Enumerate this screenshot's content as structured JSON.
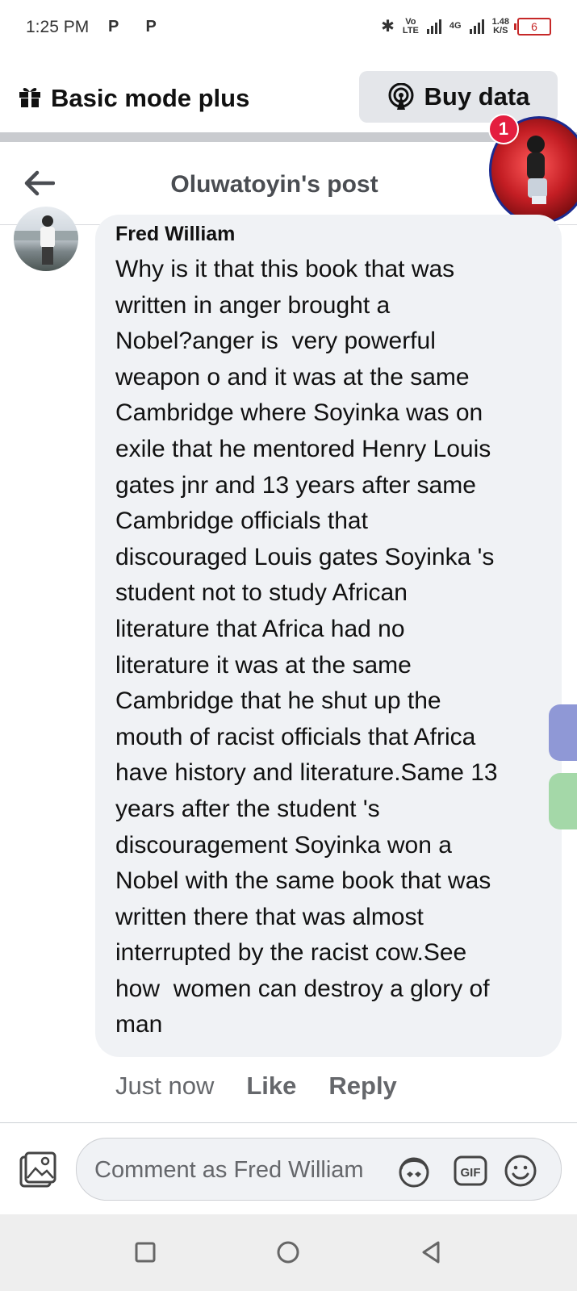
{
  "status_bar": {
    "time": "1:25 PM",
    "app_icons": "P P",
    "volte": "Vo\nLTE",
    "network": "4G",
    "speed": "1.48\nK/S",
    "battery": "6"
  },
  "top_bar": {
    "mode_label": "Basic mode plus",
    "buy_data_label": "Buy data"
  },
  "header": {
    "title": "Oluwatoyin's post"
  },
  "chat_head": {
    "badge_count": "1"
  },
  "comment": {
    "author": "Fred William",
    "text": "Why is it that this book that was\nwritten in anger brought a\nNobel?anger is  very powerful\nweapon o and it was at the same\nCambridge where Soyinka was on\nexile that he mentored Henry Louis\ngates jnr and 13 years after same\nCambridge officials that\ndiscouraged Louis gates Soyinka 's\nstudent not to study African\nliterature that Africa had no\nliterature it was at the same\nCambridge that he shut up the\nmouth of racist officials that Africa\nhave history and literature.Same 13\nyears after the student 's\ndiscouragement Soyinka won a\nNobel with the same book that was\nwritten there that was almost\ninterrupted by the racist cow.See\nhow  women can destroy a glory of\nman",
    "timestamp": "Just now",
    "like_label": "Like",
    "reply_label": "Reply"
  },
  "composer": {
    "placeholder": "Comment as Fred William",
    "gif_label": "GIF"
  },
  "icons": {
    "gift": "gift-icon",
    "broadcast": "broadcast-icon",
    "back": "back-arrow-icon",
    "photo": "photo-icon",
    "avatar_sticker": "avatar-sticker-icon",
    "gif": "gif-icon",
    "emoji": "emoji-icon",
    "nav_recent": "square-icon",
    "nav_home": "circle-icon",
    "nav_back": "triangle-back-icon"
  },
  "colors": {
    "badge": "#e41e3f",
    "bubble": "#f0f2f5",
    "muted_text": "#65676b"
  }
}
